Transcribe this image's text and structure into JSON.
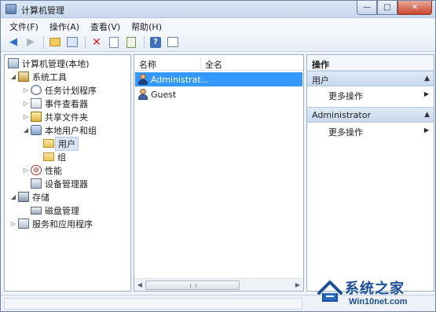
{
  "window": {
    "title": "计算机管理"
  },
  "menubar": {
    "items": [
      "文件(F)",
      "操作(A)",
      "查看(V)",
      "帮助(H)"
    ]
  },
  "toolbar": {
    "icons": [
      "back-icon",
      "forward-icon",
      "up-folder-icon",
      "show-tree-icon",
      "delete-icon",
      "properties-icon",
      "export-icon",
      "help-icon",
      "show-action-pane-icon"
    ]
  },
  "tree": {
    "root": "计算机管理(本地)",
    "system_tools": "系统工具",
    "task_scheduler": "任务计划程序",
    "event_viewer": "事件查看器",
    "shared_folders": "共享文件夹",
    "local_users_groups": "本地用户和组",
    "users": "用户",
    "groups": "组",
    "performance": "性能",
    "device_manager": "设备管理器",
    "storage": "存储",
    "disk_management": "磁盘管理",
    "services_apps": "服务和应用程序"
  },
  "list": {
    "col_name": "名称",
    "col_fullname": "全名",
    "rows": [
      {
        "name": "Administrat...",
        "fullname": ""
      },
      {
        "name": "Guest",
        "fullname": ""
      }
    ]
  },
  "actions": {
    "title": "操作",
    "section1": "用户",
    "section1_more": "更多操作",
    "section2": "Administrator",
    "section2_more": "更多操作"
  },
  "watermark": {
    "title": "系统之家",
    "sub": "Win10net.com"
  },
  "colors": {
    "selection": "#3399ff",
    "accent": "#1c4f9a"
  }
}
